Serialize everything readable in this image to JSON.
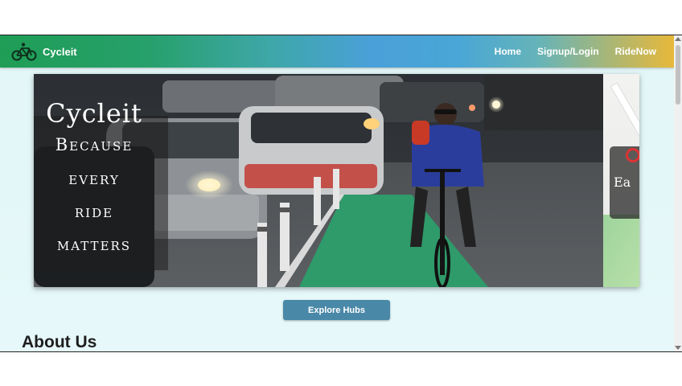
{
  "navbar": {
    "brand": "Cycleit",
    "links": [
      "Home",
      "Signup/Login",
      "RideNow"
    ]
  },
  "carousel": {
    "caption_title": "Cycleit",
    "caption_lines": [
      "Because",
      "every",
      "ride",
      "matters"
    ],
    "next_slide_caption": "Ea"
  },
  "hero": {
    "explore_label": "Explore Hubs"
  },
  "about": {
    "heading": "About Us"
  },
  "colors": {
    "nav_gradient_start": "#1f9d56",
    "nav_gradient_mid": "#4aa0d8",
    "nav_gradient_end": "#e7b83a",
    "button": "#4a88a8",
    "page_bg": "#e3f6f7"
  },
  "icons": [
    "bicycle-logo-icon",
    "scroll-up-icon",
    "scroll-down-icon"
  ]
}
